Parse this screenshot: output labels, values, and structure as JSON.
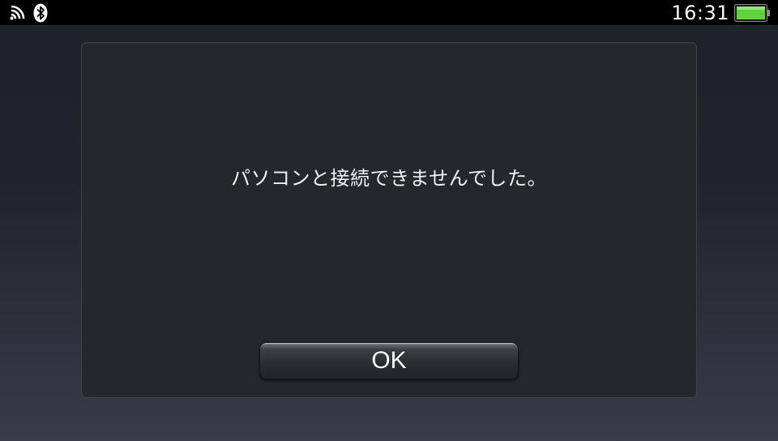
{
  "status_bar": {
    "time": "16:31",
    "icons": {
      "network": "wifi-signal-icon",
      "bluetooth": "bluetooth-icon",
      "battery": "battery-full-icon"
    },
    "battery_level": 1.0,
    "battery_color": "#5fd33a"
  },
  "dialog": {
    "message": "パソコンと接続できませんでした。",
    "ok_label": "OK"
  }
}
